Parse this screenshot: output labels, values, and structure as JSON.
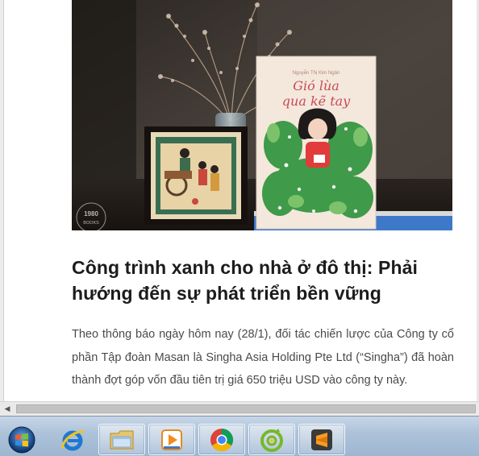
{
  "article": {
    "image_alt": "Sách Gió lùa qua kẽ tay và tranh minh họa",
    "image_watermark": "1980 BOOKS",
    "book_cover_title": "Gió lùa qua kẽ tay",
    "title": "Công trình xanh cho nhà ở đô thị: Phải hướng đến sự phát triển bền vững",
    "summary": "Theo thông báo ngày hôm nay (28/1), đối tác chiến lược của Công ty cổ phần Tập đoàn Masan là Singha Asia Holding Pte Ltd (“Singha”) đã hoàn thành đợt góp vốn đầu tiên trị giá 650 triệu USD vào công ty này."
  },
  "scrollbar": {
    "left_arrow_icon": "triangle-left-icon"
  },
  "taskbar": {
    "start_icon": "windows-start-icon",
    "apps": [
      {
        "name": "internet-explorer",
        "icon": "ie-icon",
        "open": false
      },
      {
        "name": "file-explorer",
        "icon": "folder-icon",
        "open": true
      },
      {
        "name": "media-player",
        "icon": "media-player-icon",
        "open": true
      },
      {
        "name": "google-chrome",
        "icon": "chrome-icon",
        "open": true
      },
      {
        "name": "coc-coc-browser",
        "icon": "coccoc-icon",
        "open": true
      },
      {
        "name": "sublime-text",
        "icon": "sublime-icon",
        "open": true
      }
    ]
  },
  "colors": {
    "taskbar": "#aec3da",
    "title_text": "#1c1c1c",
    "body_text": "#4a4a4a",
    "book_cover": "#f4e8dc",
    "book_title_red": "#c94a57"
  }
}
